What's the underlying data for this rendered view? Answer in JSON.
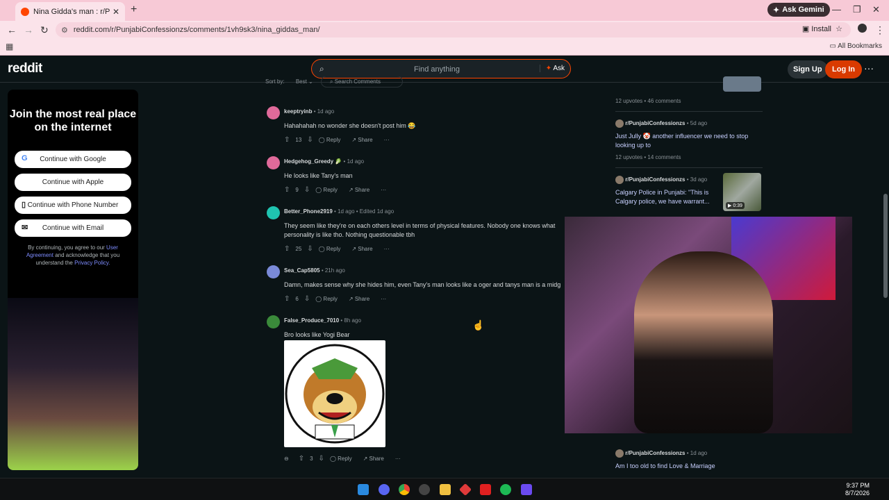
{
  "browser": {
    "tab_title": "Nina Gidda's man : r/PunjabiCo",
    "tab_close": "✕",
    "new_tab": "+",
    "ask_gemini": "Ask Gemini",
    "url": "reddit.com/r/PunjabiConfessionzs/comments/1vh9sk3/nina_giddas_man/",
    "install": "Install",
    "all_bookmarks": "All Bookmarks"
  },
  "header": {
    "logo": "reddit",
    "search_placeholder": "Find anything",
    "ask": "Ask",
    "signup": "Sign Up",
    "login": "Log In"
  },
  "left_panel": {
    "title": "Join the most real place on the internet",
    "buttons": [
      {
        "label": "Continue with Google",
        "icon": "G"
      },
      {
        "label": "Continue with Apple",
        "icon": ""
      },
      {
        "label": "Continue with Phone Number",
        "icon": "▯"
      },
      {
        "label": "Continue with Email",
        "icon": "✉"
      }
    ],
    "terms_pre": "By continuing, you agree to our",
    "terms_link1": "User Agreement",
    "terms_mid": "and acknowledge that you understand the",
    "terms_link2": "Privacy Policy."
  },
  "sort": {
    "label": "Sort by:",
    "value": "Best",
    "search_placeholder": "Search Comments"
  },
  "comments": [
    {
      "user": "keeptryinb",
      "time": "1d ago",
      "edited": "",
      "body": "Hahahahah no wonder she doesn't post him 😂",
      "votes": "13",
      "avatar_color": "#e06a9a"
    },
    {
      "user": "Hedgehog_Greedy",
      "time": "1d ago",
      "edited": "",
      "body": "He looks like Tany's man",
      "votes": "9",
      "avatar_color": "#e06a9a"
    },
    {
      "user": "Better_Phone2919",
      "time": "1d ago",
      "edited": "Edited 1d ago",
      "body": "They seem like they're on each others level in terms of physical features. Nobody one knows what personality is like tho. Nothing questionable tbh",
      "votes": "25",
      "avatar_color": "#1fc4b0"
    },
    {
      "user": "Sea_Cap5805",
      "time": "21h ago",
      "edited": "",
      "body": "Damn, makes sense why she hides him, even Tany's man looks like a oger and tanys man is a midg",
      "votes": "6",
      "avatar_color": "#7a8ad8"
    },
    {
      "user": "False_Produce_7010",
      "time": "8h ago",
      "edited": "",
      "body": "Bro looks like Yogi Bear",
      "votes": "3",
      "avatar_color": "#3a8a3a"
    }
  ],
  "actions": {
    "reply": "Reply",
    "share": "Share",
    "more": "···"
  },
  "sidebar": {
    "top_meta": {
      "upvotes": "12 upvotes",
      "comments": "46 comments"
    },
    "posts": [
      {
        "sub": "r/PunjabiConfessionzs",
        "time": "5d ago",
        "title": "Just Jully 🤡 another influencer we need to stop looking up to",
        "upvotes": "12 upvotes",
        "comments": "14 comments"
      },
      {
        "sub": "r/PunjabiConfessionzs",
        "time": "3d ago",
        "title": "Calgary Police in Punjabi: \"This is Calgary police, we have warrant...",
        "duration": "0:39"
      },
      {
        "sub": "r/PunjabiConfessionzs",
        "time": "1d ago",
        "title": "Am I too old to find Love & Marriage"
      }
    ]
  },
  "taskbar": {
    "time": "9:37 PM",
    "date": "8/7/2026"
  }
}
